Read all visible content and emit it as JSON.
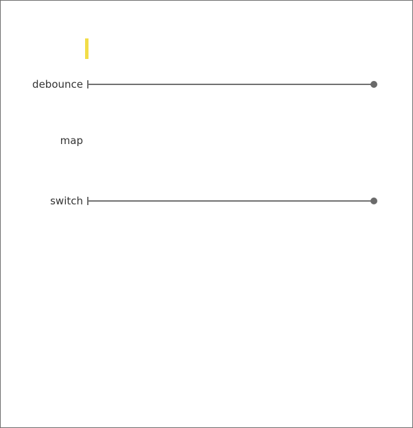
{
  "rows": [
    {
      "label": "debounce"
    },
    {
      "label": "map"
    },
    {
      "label": "switch"
    }
  ],
  "colors": {
    "cursor": "#f2dd48",
    "timeline": "#707070",
    "text": "#333333",
    "border": "#6e6e6e"
  },
  "icons": {
    "timeline_start": "start-tick-icon",
    "timeline_end": "end-dot-icon"
  }
}
